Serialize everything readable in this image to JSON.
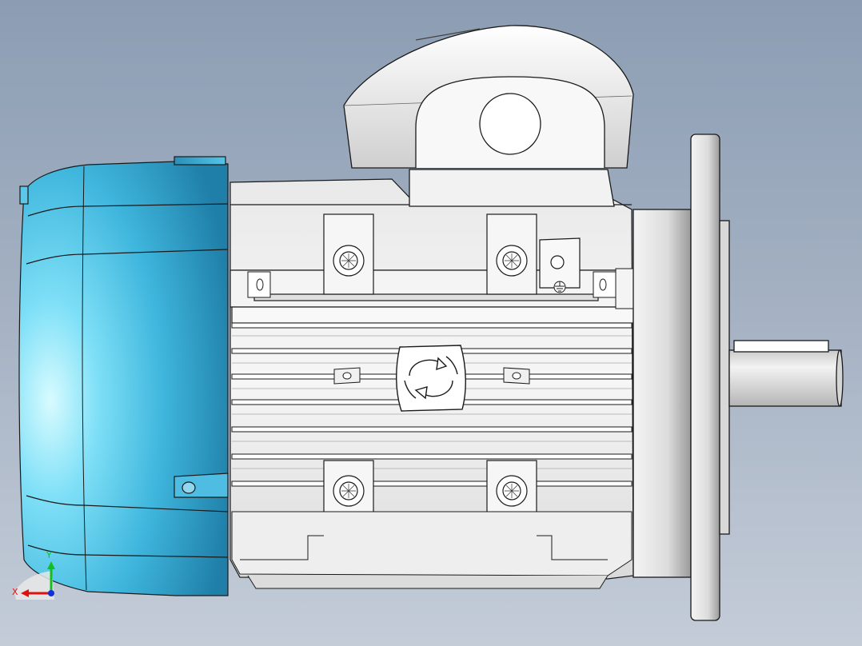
{
  "viewport": {
    "background_top": "#8c9db3",
    "background_bottom": "#c4ccd8"
  },
  "model": {
    "fan_cover_color": "#3fb6dd",
    "housing_color": "#f2f2f2",
    "edge_color": "#1a1a1a"
  },
  "triad": {
    "x_label": "X",
    "y_label": "Y",
    "x_color": "#e01010",
    "y_color": "#10c020",
    "z_color": "#1030e0"
  }
}
